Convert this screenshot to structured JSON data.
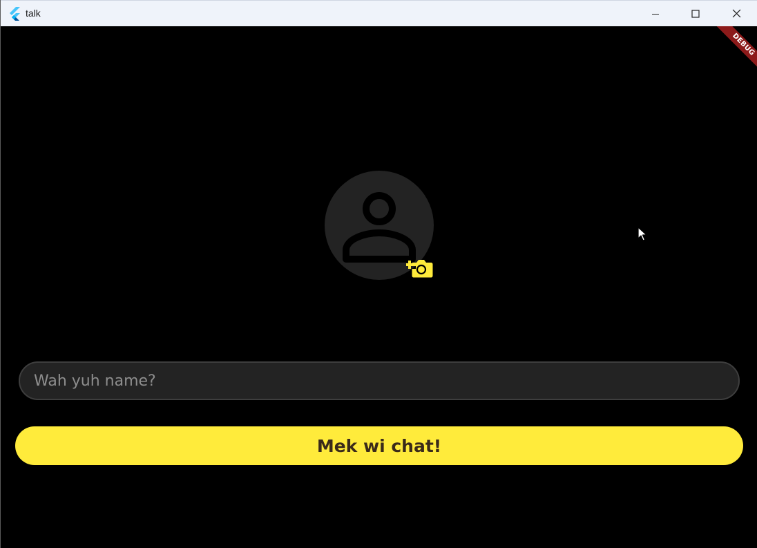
{
  "window": {
    "title": "talk",
    "controls": {
      "minimize": "minimize-icon",
      "maximize": "maximize-icon",
      "close": "close-icon"
    }
  },
  "debug_banner": {
    "label": "DEBUG",
    "color": "#8c1a1a"
  },
  "profile": {
    "avatar_icon": "person-icon",
    "add_photo_icon": "add-a-photo-icon"
  },
  "form": {
    "name_placeholder": "Wah yuh name?",
    "name_value": "",
    "submit_label": "Mek wi chat!"
  },
  "colors": {
    "accent": "#ffeb3b",
    "background": "#000000",
    "surface": "#232323",
    "button_text": "#3a2a1a"
  }
}
